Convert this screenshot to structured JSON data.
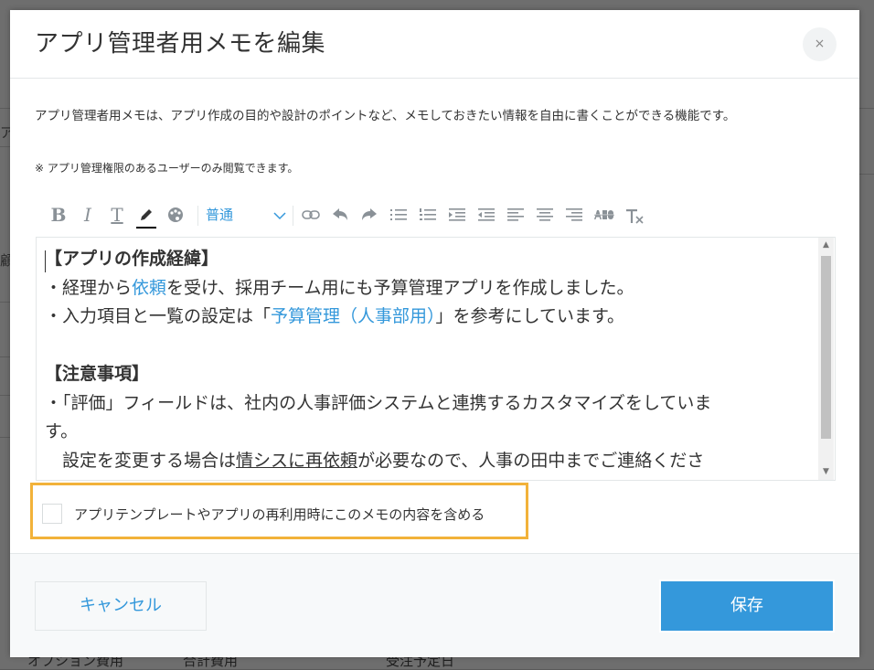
{
  "dialog": {
    "title": "アプリ管理者用メモを編集",
    "close_symbol": "×",
    "description": "アプリ管理者用メモは、アプリ作成の目的や設計のポイントなど、メモしておきたい情報を自由に書くことができる機能です。",
    "note": "※ アプリ管理権限のあるユーザーのみ閲覧できます。"
  },
  "toolbar": {
    "bold": "B",
    "italic": "I",
    "text_size": "T",
    "font_select": "普通",
    "icons": [
      "bold-icon",
      "italic-icon",
      "text-size-icon",
      "pencil-icon",
      "palette-icon",
      "link-icon",
      "undo-icon",
      "redo-icon",
      "bulleted-list-icon",
      "numbered-list-icon",
      "indent-icon",
      "outdent-icon",
      "align-left-icon",
      "align-center-icon",
      "align-right-icon",
      "strikethrough-icon",
      "clear-format-icon"
    ]
  },
  "editor": {
    "heading1": "【アプリの作成経緯】",
    "line1_pre": "・経理から",
    "line1_link": "依頼",
    "line1_post": "を受け、採用チーム用にも予算管理アプリを作成しました。",
    "line2_pre": "・入力項目と一覧の設定は「",
    "line2_link": "予算管理（人事部用）",
    "line2_post": "」を参考にしています。",
    "heading2": "【注意事項】",
    "line3": "・「評価」フィールドは、社内の人事評価システムと連携するカスタマイズをしていま",
    "line4": "す。",
    "line5_pre": "　設定を変更する場合は",
    "line5_ul": "情シスに再依頼",
    "line5_post": "が必要なので、人事の田中までご連絡くださ"
  },
  "checkbox": {
    "label": "アプリテンプレートやアプリの再利用時にこのメモの内容を含める",
    "checked": false
  },
  "footer": {
    "cancel_label": "キャンセル",
    "save_label": "保存"
  },
  "background": {
    "left_fragment_1": "ア",
    "left_fragment_2": "顧",
    "bottom_1": "オプション費用",
    "bottom_2": "合計費用",
    "bottom_3": "受注予定日"
  },
  "colors": {
    "accent": "#3498db",
    "highlight": "#f2b23a",
    "overlay": "#6e6e6e"
  }
}
